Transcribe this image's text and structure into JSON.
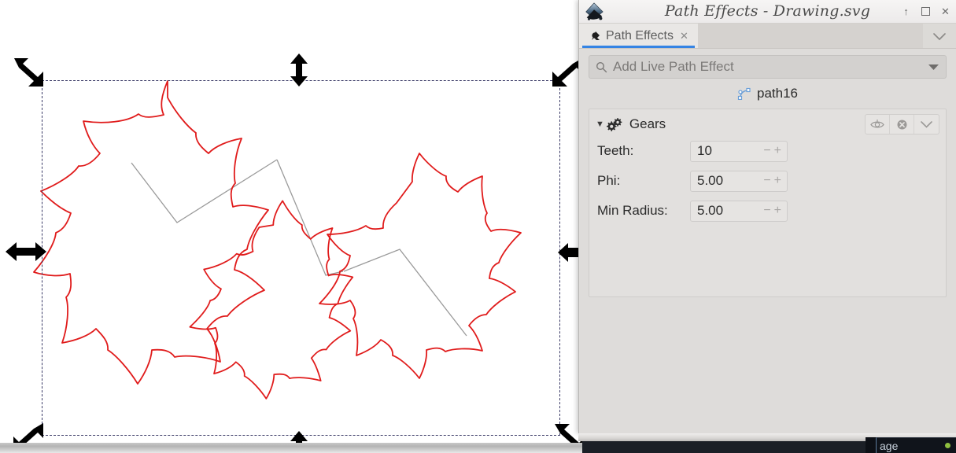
{
  "window": {
    "title": "Path Effects - Drawing.svg",
    "app_icon": "inkscape-logo-icon",
    "buttons": [
      {
        "name": "shade-button",
        "glyph": "↑"
      },
      {
        "name": "maximize-button",
        "glyph": "☐"
      },
      {
        "name": "close-button",
        "glyph": "✕"
      }
    ]
  },
  "tabs": {
    "active": "Path Effects",
    "close_glyph": "✕",
    "menu_glyph": "⌄"
  },
  "search": {
    "placeholder": "Add Live Path Effect",
    "icon": "search-icon",
    "dropdown_icon": "chevron-down-icon"
  },
  "selected_object": {
    "label": "path16",
    "icon": "path-node-icon"
  },
  "effect": {
    "name": "Gears",
    "icon": "gears-icon",
    "expander_glyph": "▼",
    "actions": [
      {
        "name": "toggle-visibility-button",
        "icon": "eye-icon"
      },
      {
        "name": "remove-effect-button",
        "icon": "remove-circle-icon"
      },
      {
        "name": "effect-menu-button",
        "icon": "chevron-down-icon"
      }
    ],
    "params": [
      {
        "label": "Teeth:",
        "value": "10"
      },
      {
        "label": "Phi:",
        "value": "5.00"
      },
      {
        "label": "Min Radius:",
        "value": "5.00"
      }
    ]
  },
  "canvas": {
    "stroke_color": "#e01b1b",
    "helper_color": "#9a9a9a",
    "selection_color": "#3a3a66",
    "background": "#ffffff",
    "handles": [
      {
        "name": "scale-handle-top-left",
        "type": "diagonal-nwse"
      },
      {
        "name": "scale-handle-top-center",
        "type": "vertical"
      },
      {
        "name": "scale-handle-top-right",
        "type": "diagonal-nesw"
      },
      {
        "name": "scale-handle-middle-left",
        "type": "horizontal"
      },
      {
        "name": "scale-handle-middle-right",
        "type": "horizontal-clipped"
      },
      {
        "name": "scale-handle-bottom-left",
        "type": "diagonal-nesw"
      },
      {
        "name": "scale-handle-bottom-center",
        "type": "vertical-clipped"
      },
      {
        "name": "scale-handle-bottom-right",
        "type": "diagonal-nwse"
      }
    ]
  },
  "background_window": {
    "text": "age"
  }
}
